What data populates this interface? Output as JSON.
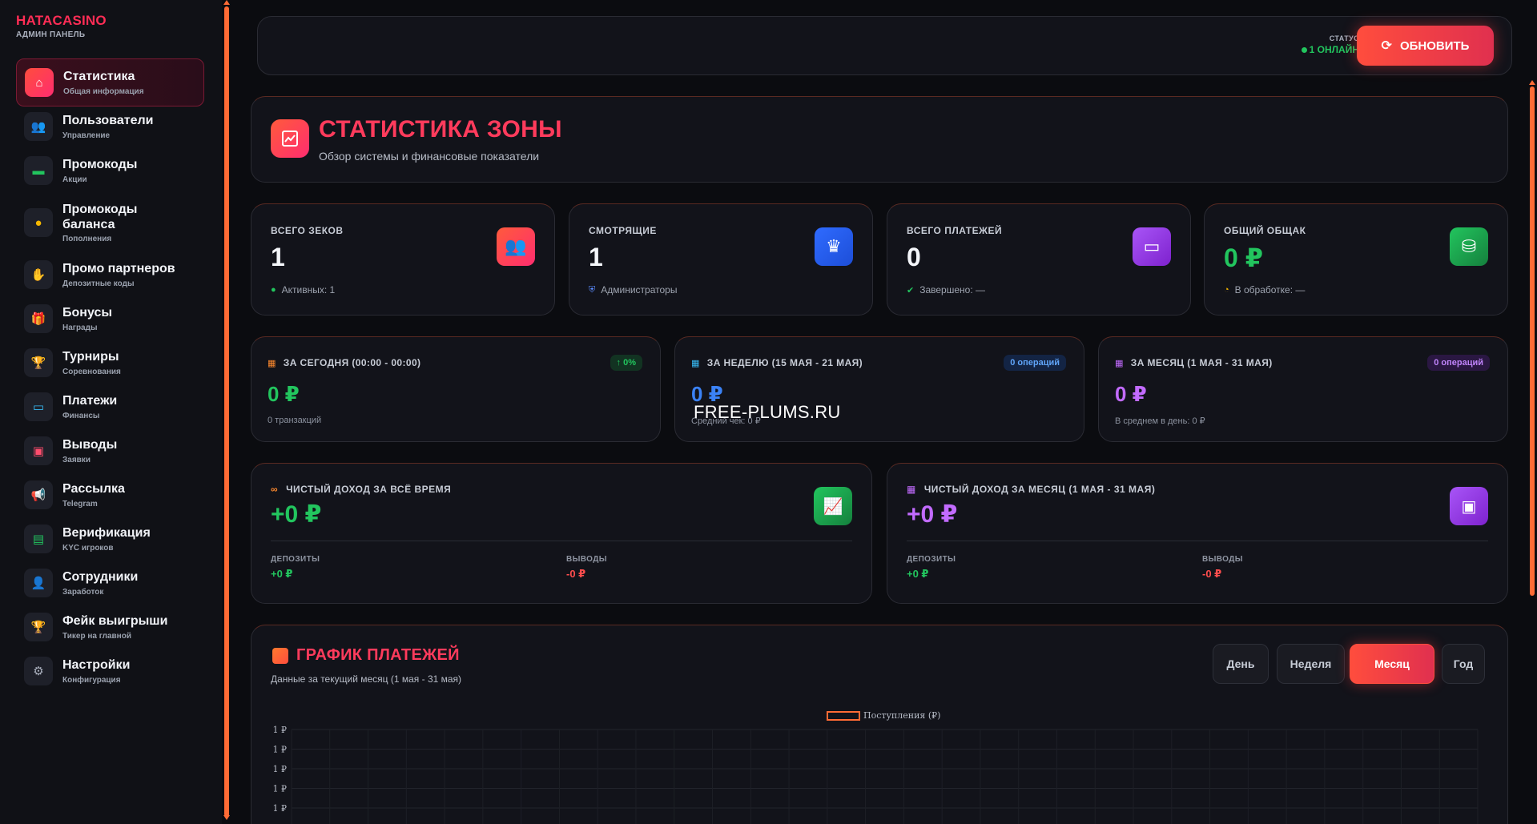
{
  "brand": {
    "title": "HATACASINO",
    "subtitle": "АДМИН ПАНЕЛЬ"
  },
  "sidebar": {
    "items": [
      {
        "label": "Статистика",
        "sub": "Общая информация",
        "icon": "home-icon",
        "glyph": "⌂",
        "color": "#ffffff",
        "active": true
      },
      {
        "label": "Пользователи",
        "sub": "Управление",
        "icon": "users-icon",
        "glyph": "👥",
        "color": "#ff5a8a",
        "active": false
      },
      {
        "label": "Промокоды",
        "sub": "Акции",
        "icon": "ticket-icon",
        "glyph": "▬",
        "color": "#22c55e",
        "active": false
      },
      {
        "label": "Промокоды баланса",
        "sub": "Пополнения",
        "icon": "coins-icon",
        "glyph": "●",
        "color": "#f5b700",
        "active": false
      },
      {
        "label": "Промо партнеров",
        "sub": "Депозитные коды",
        "icon": "handshake-icon",
        "glyph": "✋",
        "color": "#5b8cff",
        "active": false
      },
      {
        "label": "Бонусы",
        "sub": "Награды",
        "icon": "gift-icon",
        "glyph": "🎁",
        "color": "#c26bff",
        "active": false
      },
      {
        "label": "Турниры",
        "sub": "Соревнования",
        "icon": "trophy-icon",
        "glyph": "🏆",
        "color": "#f5b700",
        "active": false
      },
      {
        "label": "Платежи",
        "sub": "Финансы",
        "icon": "card-icon",
        "glyph": "▭",
        "color": "#38bdf8",
        "active": false
      },
      {
        "label": "Выводы",
        "sub": "Заявки",
        "icon": "money-icon",
        "glyph": "▣",
        "color": "#ff4d6d",
        "active": false
      },
      {
        "label": "Рассылка",
        "sub": "Telegram",
        "icon": "megaphone-icon",
        "glyph": "📢",
        "color": "#f5b700",
        "active": false
      },
      {
        "label": "Верификация",
        "sub": "KYC игроков",
        "icon": "id-card-icon",
        "glyph": "▤",
        "color": "#22c55e",
        "active": false
      },
      {
        "label": "Сотрудники",
        "sub": "Заработок",
        "icon": "user-tie-icon",
        "glyph": "👤",
        "color": "#6b8cff",
        "active": false
      },
      {
        "label": "Фейк выигрыши",
        "sub": "Тикер на главной",
        "icon": "trophy-icon",
        "glyph": "🏆",
        "color": "#f5b700",
        "active": false
      },
      {
        "label": "Настройки",
        "sub": "Конфигурация",
        "icon": "gear-icon",
        "glyph": "⚙",
        "color": "#aab0bd",
        "active": false
      }
    ]
  },
  "topbar": {
    "status_label": "СТАТУС",
    "status_value": "1 ОНЛАЙН",
    "refresh_label": "ОБНОВИТЬ"
  },
  "header": {
    "title": "СТАТИСТИКА ЗОНЫ",
    "subtitle": "Обзор системы и финансовые показатели"
  },
  "stats": [
    {
      "label": "ВСЕГО ЗЕКОВ",
      "value": "1",
      "foot": "Активных: 1",
      "foot_icon": "●",
      "foot_color": "#22c55e",
      "icon": "users-icon",
      "glyph": "👥",
      "bg": "linear-gradient(135deg,#ff5a3c,#ff2d6f)",
      "value_color": "#f4f6fa"
    },
    {
      "label": "СМОТРЯЩИЕ",
      "value": "1",
      "foot": "Администраторы",
      "foot_icon": "⛨",
      "foot_color": "#5b8cff",
      "icon": "crown-icon",
      "glyph": "♛",
      "bg": "linear-gradient(135deg,#2f6bff,#1d4ed8)",
      "value_color": "#f4f6fa"
    },
    {
      "label": "ВСЕГО ПЛАТЕЖЕЙ",
      "value": "0",
      "foot": "Завершено: —",
      "foot_icon": "✔",
      "foot_color": "#22c55e",
      "icon": "card-icon",
      "glyph": "▭",
      "bg": "linear-gradient(135deg,#a855f7,#7e22ce)",
      "value_color": "#f4f6fa"
    },
    {
      "label": "ОБЩИЙ ОБЩАК",
      "value": "0 ₽",
      "foot": "В обработке: —",
      "foot_icon": "◔",
      "foot_color": "#f5b700",
      "icon": "coins-icon",
      "glyph": "⛁",
      "bg": "linear-gradient(135deg,#22c55e,#15803d)",
      "value_color": "#22c55e"
    }
  ],
  "periods": [
    {
      "label": "ЗА СЕГОДНЯ (00:00 - 00:00)",
      "value": "0 ₽",
      "foot": "0 транзакций",
      "badge": "↑ 0%",
      "icon": "calendar-icon",
      "icon_color": "#ff8a2e",
      "value_color": "#22c55e",
      "badge_color": "#22c55e",
      "badge_bg": "#123322"
    },
    {
      "label": "ЗА НЕДЕЛЮ (15 МАЯ - 21 МАЯ)",
      "value": "0 ₽",
      "foot": "Средний чек: 0 ₽",
      "badge": "0 операций",
      "icon": "calendar-week-icon",
      "icon_color": "#38bdf8",
      "value_color": "#3b82f6",
      "badge_color": "#60a5fa",
      "badge_bg": "#132444"
    },
    {
      "label": "ЗА МЕСЯЦ (1 МАЯ - 31 МАЯ)",
      "value": "0 ₽",
      "foot": "В среднем в день: 0 ₽",
      "badge": "0 операций",
      "icon": "calendar-month-icon",
      "icon_color": "#c26bff",
      "value_color": "#c26bff",
      "badge_color": "#c084fc",
      "badge_bg": "#2a1742"
    }
  ],
  "income": [
    {
      "label": "ЧИСТЫЙ ДОХОД ЗА ВСЁ ВРЕМЯ",
      "value": "+0 ₽",
      "value_color": "#22c55e",
      "label_icon": "∞",
      "label_icon_color": "#ff8a2e",
      "icon": "chart-line-icon",
      "glyph": "📈",
      "bg": "linear-gradient(135deg,#22c55e,#15803d)",
      "deposits_label": "ДЕПОЗИТЫ",
      "deposits_value": "+0 ₽",
      "withdrawals_label": "ВЫВОДЫ",
      "withdrawals_value": "-0 ₽"
    },
    {
      "label": "ЧИСТЫЙ ДОХОД ЗА МЕСЯЦ (1 МАЯ - 31 МАЯ)",
      "value": "+0 ₽",
      "value_color": "#c26bff",
      "label_icon": "▦",
      "label_icon_color": "#c26bff",
      "icon": "wallet-icon",
      "glyph": "▣",
      "bg": "linear-gradient(135deg,#a855f7,#7e22ce)",
      "deposits_label": "ДЕПОЗИТЫ",
      "deposits_value": "+0 ₽",
      "withdrawals_label": "ВЫВОДЫ",
      "withdrawals_value": "-0 ₽"
    }
  ],
  "payments_chart": {
    "title": "ГРАФИК ПЛАТЕЖЕЙ",
    "subtitle": "Данные за текущий месяц (1 мая - 31 мая)",
    "ranges": [
      "День",
      "Неделя",
      "Месяц",
      "Год"
    ],
    "active_range": "Месяц",
    "legend": "Поступления (₽)",
    "y_ticks": [
      "1 ₽",
      "1 ₽",
      "1 ₽",
      "1 ₽",
      "1 ₽"
    ],
    "series_color": "#ff6b35"
  },
  "watermark": "FREE-PLUMS.RU"
}
